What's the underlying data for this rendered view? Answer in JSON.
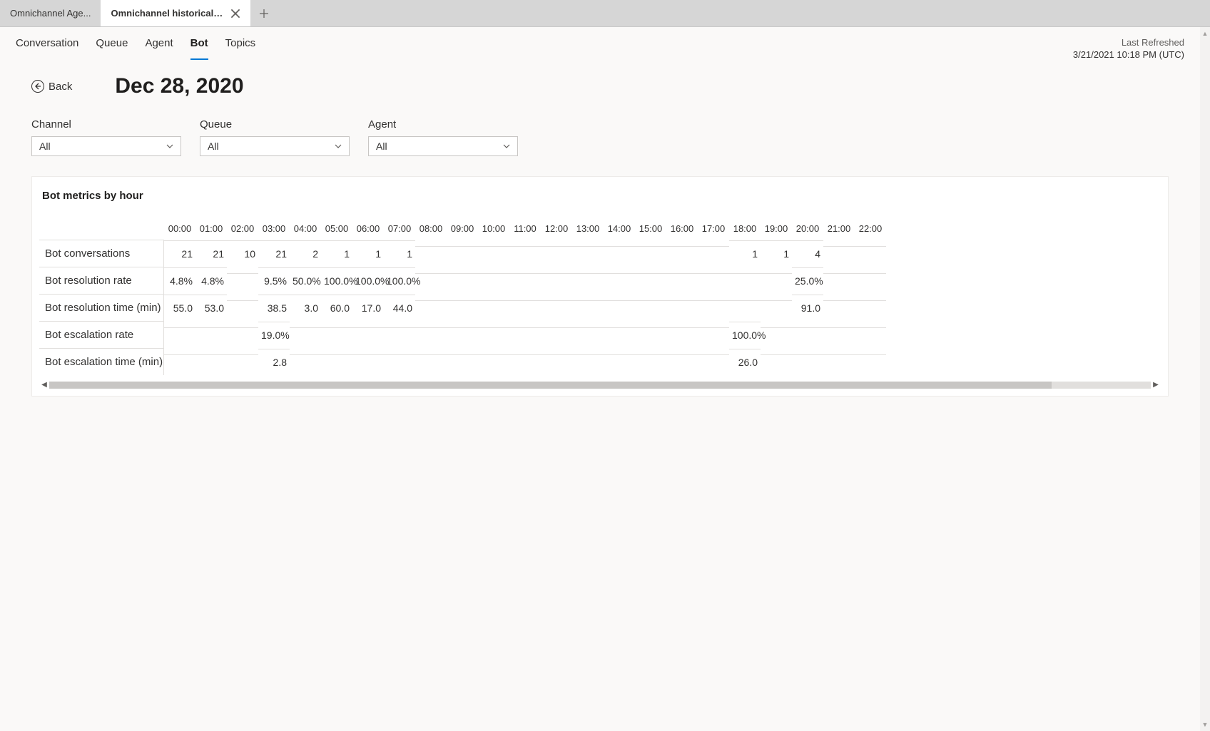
{
  "tabs": {
    "inactive": "Omnichannel Age...",
    "active": "Omnichannel historical an..."
  },
  "nav": {
    "items": [
      "Conversation",
      "Queue",
      "Agent",
      "Bot",
      "Topics"
    ],
    "active_index": 3
  },
  "refresh": {
    "label": "Last Refreshed",
    "value": "3/21/2021 10:18 PM (UTC)"
  },
  "back_label": "Back",
  "page_title": "Dec 28, 2020",
  "filters": [
    {
      "label": "Channel",
      "value": "All"
    },
    {
      "label": "Queue",
      "value": "All"
    },
    {
      "label": "Agent",
      "value": "All"
    }
  ],
  "card_title": "Bot metrics by hour",
  "hours": [
    "00:00",
    "01:00",
    "02:00",
    "03:00",
    "04:00",
    "05:00",
    "06:00",
    "07:00",
    "08:00",
    "09:00",
    "10:00",
    "11:00",
    "12:00",
    "13:00",
    "14:00",
    "15:00",
    "16:00",
    "17:00",
    "18:00",
    "19:00",
    "20:00",
    "21:00",
    "22:00"
  ],
  "chart_data": {
    "type": "table",
    "title": "Bot metrics by hour",
    "columns": [
      "00:00",
      "01:00",
      "02:00",
      "03:00",
      "04:00",
      "05:00",
      "06:00",
      "07:00",
      "08:00",
      "09:00",
      "10:00",
      "11:00",
      "12:00",
      "13:00",
      "14:00",
      "15:00",
      "16:00",
      "17:00",
      "18:00",
      "19:00",
      "20:00",
      "21:00",
      "22:00"
    ],
    "rows": [
      {
        "name": "Bot conversations",
        "values": [
          "21",
          "21",
          "10",
          "21",
          "2",
          "1",
          "1",
          "1",
          "",
          "",
          "",
          "",
          "",
          "",
          "",
          "",
          "",
          "",
          "1",
          "1",
          "4",
          "",
          ""
        ]
      },
      {
        "name": "Bot resolution rate",
        "values": [
          "4.8%",
          "4.8%",
          "",
          "9.5%",
          "50.0%",
          "100.0%",
          "100.0%",
          "100.0%",
          "",
          "",
          "",
          "",
          "",
          "",
          "",
          "",
          "",
          "",
          "",
          "",
          "25.0%",
          "",
          ""
        ]
      },
      {
        "name": "Bot resolution time (min)",
        "values": [
          "55.0",
          "53.0",
          "",
          "38.5",
          "3.0",
          "60.0",
          "17.0",
          "44.0",
          "",
          "",
          "",
          "",
          "",
          "",
          "",
          "",
          "",
          "",
          "",
          "",
          "91.0",
          "",
          ""
        ]
      },
      {
        "name": "Bot escalation rate",
        "values": [
          "",
          "",
          "",
          "19.0%",
          "",
          "",
          "",
          "",
          "",
          "",
          "",
          "",
          "",
          "",
          "",
          "",
          "",
          "",
          "100.0%",
          "",
          "",
          "",
          ""
        ]
      },
      {
        "name": "Bot escalation time (min)",
        "values": [
          "",
          "",
          "",
          "2.8",
          "",
          "",
          "",
          "",
          "",
          "",
          "",
          "",
          "",
          "",
          "",
          "",
          "",
          "",
          "26.0",
          "",
          "",
          "",
          ""
        ]
      }
    ]
  }
}
